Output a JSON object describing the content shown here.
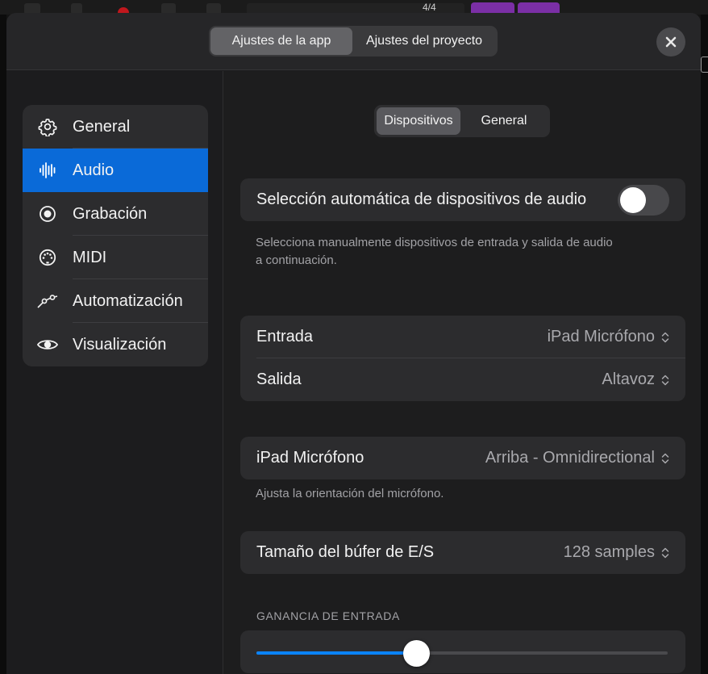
{
  "header": {
    "tabs": [
      {
        "label": "Ajustes de la app",
        "active": true
      },
      {
        "label": "Ajustes del proyecto",
        "active": false
      }
    ],
    "close_icon": "close-icon"
  },
  "background_toolbar": {
    "time_signature": "4/4"
  },
  "sidebar": {
    "items": [
      {
        "label": "General",
        "icon": "gear-icon",
        "active": false
      },
      {
        "label": "Audio",
        "icon": "waveform-icon",
        "active": true
      },
      {
        "label": "Grabación",
        "icon": "record-icon",
        "active": false
      },
      {
        "label": "MIDI",
        "icon": "midi-port-icon",
        "active": false
      },
      {
        "label": "Automatización",
        "icon": "automation-curve-icon",
        "active": false
      },
      {
        "label": "Visualización",
        "icon": "eye-icon",
        "active": false
      }
    ]
  },
  "main": {
    "subtabs": [
      {
        "label": "Dispositivos",
        "active": true
      },
      {
        "label": "General",
        "active": false
      }
    ],
    "auto_select": {
      "label": "Selección automática de dispositivos de audio",
      "enabled": false,
      "footnote_line1": "Selecciona manualmente dispositivos de entrada y salida de audio",
      "footnote_line2": "a continuación."
    },
    "io": {
      "input_label": "Entrada",
      "input_value": "iPad Micrófono",
      "output_label": "Salida",
      "output_value": "Altavoz"
    },
    "mic": {
      "label": "iPad Micrófono",
      "value": "Arriba - Omnidirectional",
      "footnote": "Ajusta la orientación del micrófono."
    },
    "buffer": {
      "label": "Tamaño del búfer de E/S",
      "value": "128 samples"
    },
    "gain": {
      "title": "GANANCIA DE ENTRADA",
      "level": 0.39
    }
  },
  "colors": {
    "accent": "#0a6ad8",
    "slider_fill": "#0a84ff",
    "sheet_bg": "#1d1d1e",
    "card_bg": "#2c2c2e"
  }
}
